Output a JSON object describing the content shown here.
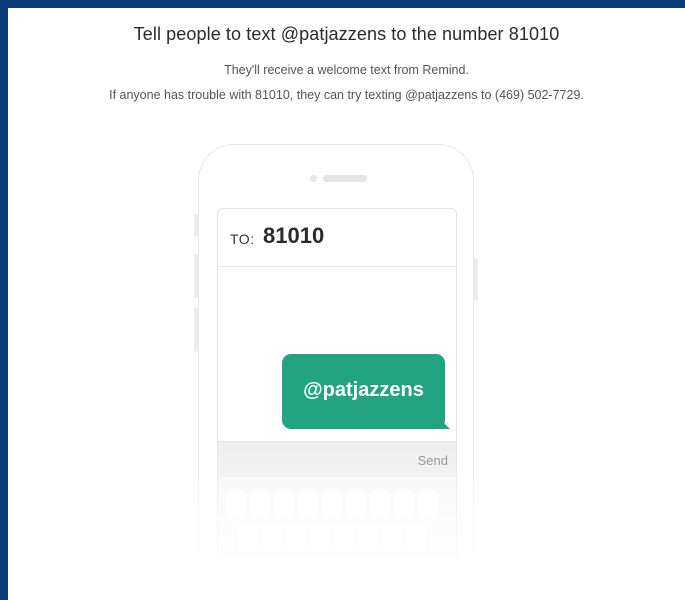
{
  "instructions": {
    "headline": "Tell people to text @patjazzens to the number 81010",
    "line1": "They'll receive a welcome text from Remind.",
    "line2": "If anyone has trouble with 81010, they can try texting @patjazzens to (469) 502-7729."
  },
  "phone": {
    "to_label": "TO:",
    "to_number": "81010",
    "message": "@patjazzens",
    "send_label": "Send"
  },
  "colors": {
    "frame_border": "#0b3a78",
    "bubble": "#22a482"
  }
}
